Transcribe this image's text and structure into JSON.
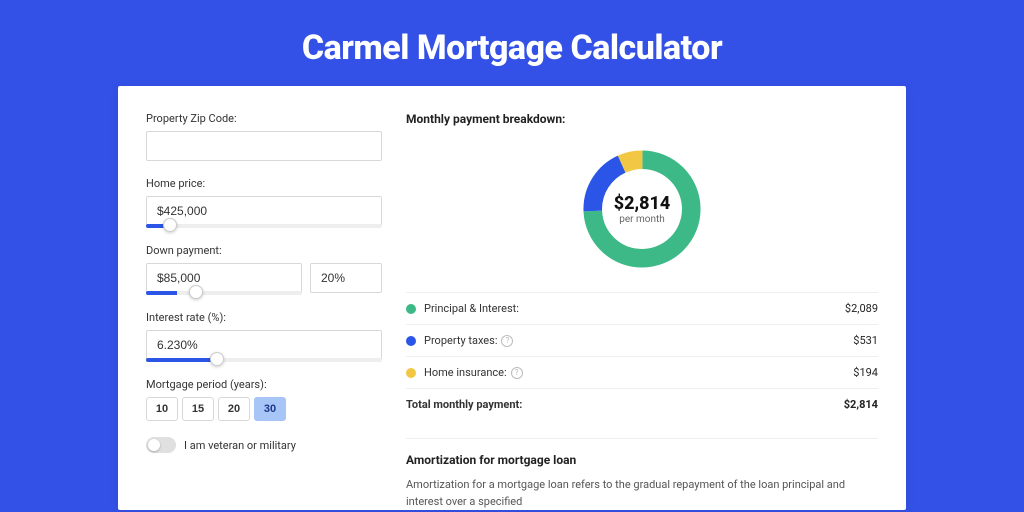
{
  "title": "Carmel Mortgage Calculator",
  "form": {
    "zip": {
      "label": "Property Zip Code:",
      "value": ""
    },
    "price": {
      "label": "Home price:",
      "value": "$425,000",
      "slider_pct": 10
    },
    "down": {
      "label": "Down payment:",
      "value": "$85,000",
      "pct": "20%",
      "slider_pct": 20
    },
    "rate": {
      "label": "Interest rate (%):",
      "value": "6.230%",
      "slider_pct": 30
    },
    "period": {
      "label": "Mortgage period (years):",
      "options": [
        "10",
        "15",
        "20",
        "30"
      ],
      "selected": "30"
    },
    "veteran": {
      "label": "I am veteran or military",
      "on": false
    }
  },
  "breakdown": {
    "title": "Monthly payment breakdown:",
    "center_amount": "$2,814",
    "center_sub": "per month",
    "items": [
      {
        "color": "#3db887",
        "label": "Principal & Interest:",
        "value": "$2,089",
        "info": false
      },
      {
        "color": "#2b55e6",
        "label": "Property taxes:",
        "value": "$531",
        "info": true
      },
      {
        "color": "#f2c744",
        "label": "Home insurance:",
        "value": "$194",
        "info": true
      }
    ],
    "total": {
      "label": "Total monthly payment:",
      "value": "$2,814"
    }
  },
  "amort": {
    "title": "Amortization for mortgage loan",
    "body": "Amortization for a mortgage loan refers to the gradual repayment of the loan principal and interest over a specified"
  },
  "chart_data": {
    "type": "pie",
    "title": "Monthly payment breakdown",
    "series": [
      {
        "name": "Principal & Interest",
        "value": 2089,
        "color": "#3db887"
      },
      {
        "name": "Property taxes",
        "value": 531,
        "color": "#2b55e6"
      },
      {
        "name": "Home insurance",
        "value": 194,
        "color": "#f2c744"
      }
    ],
    "total": 2814,
    "center_label": "$2,814 per month"
  }
}
